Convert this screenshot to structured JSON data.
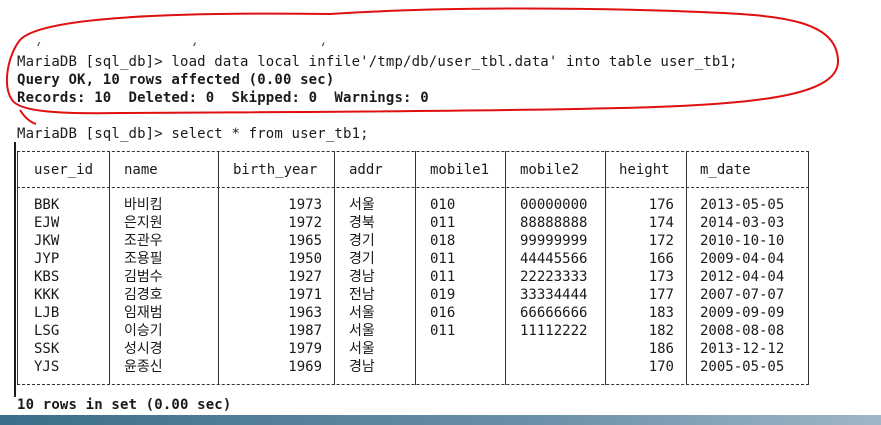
{
  "terminal": {
    "cut_line": "  ( ,  ,            /              /   ,  _   ,          .              ,",
    "cmd1": "MariaDB [sql_db]> load data local infile'/tmp/db/user_tbl.data' into table user_tb1;",
    "query_ok": "Query OK, 10 rows affected (0.00 sec)",
    "records": "Records: 10  Deleted: 0  Skipped: 0  Warnings: 0",
    "cmd2": "MariaDB [sql_db]> select * from user_tb1;",
    "border": "+---------+--------+------------+------+---------+----------+--------+------------+",
    "footer": "10 rows in set (0.00 sec)"
  },
  "table": {
    "columns": [
      "user_id",
      "name",
      "birth_year",
      "addr",
      "mobile1",
      "mobile2",
      "height",
      "m_date"
    ],
    "rows": [
      [
        "BBK",
        "바비킴",
        "1973",
        "서울",
        "010",
        "00000000",
        "176",
        "2013-05-05"
      ],
      [
        "EJW",
        "은지원",
        "1972",
        "경북",
        "011",
        "88888888",
        "174",
        "2014-03-03"
      ],
      [
        "JKW",
        "조관우",
        "1965",
        "경기",
        "018",
        "99999999",
        "172",
        "2010-10-10"
      ],
      [
        "JYP",
        "조용필",
        "1950",
        "경기",
        "011",
        "44445566",
        "166",
        "2009-04-04"
      ],
      [
        "KBS",
        "김범수",
        "1927",
        "경남",
        "011",
        "22223333",
        "173",
        "2012-04-04"
      ],
      [
        "KKK",
        "김경호",
        "1971",
        "전남",
        "019",
        "33334444",
        "177",
        "2007-07-07"
      ],
      [
        "LJB",
        "임재범",
        "1963",
        "서울",
        "016",
        "66666666",
        "183",
        "2009-09-09"
      ],
      [
        "LSG",
        "이승기",
        "1987",
        "서울",
        "011",
        "11112222",
        "182",
        "2008-08-08"
      ],
      [
        "SSK",
        "성시경",
        "1979",
        "서울",
        "",
        "",
        "186",
        "2013-12-12"
      ],
      [
        "YJS",
        "윤종신",
        "1969",
        "경남",
        "",
        "",
        "170",
        "2005-05-05"
      ]
    ]
  },
  "colors": {
    "background": "#ffffff",
    "text": "#1a1a1a",
    "annotation": "#e01010"
  }
}
